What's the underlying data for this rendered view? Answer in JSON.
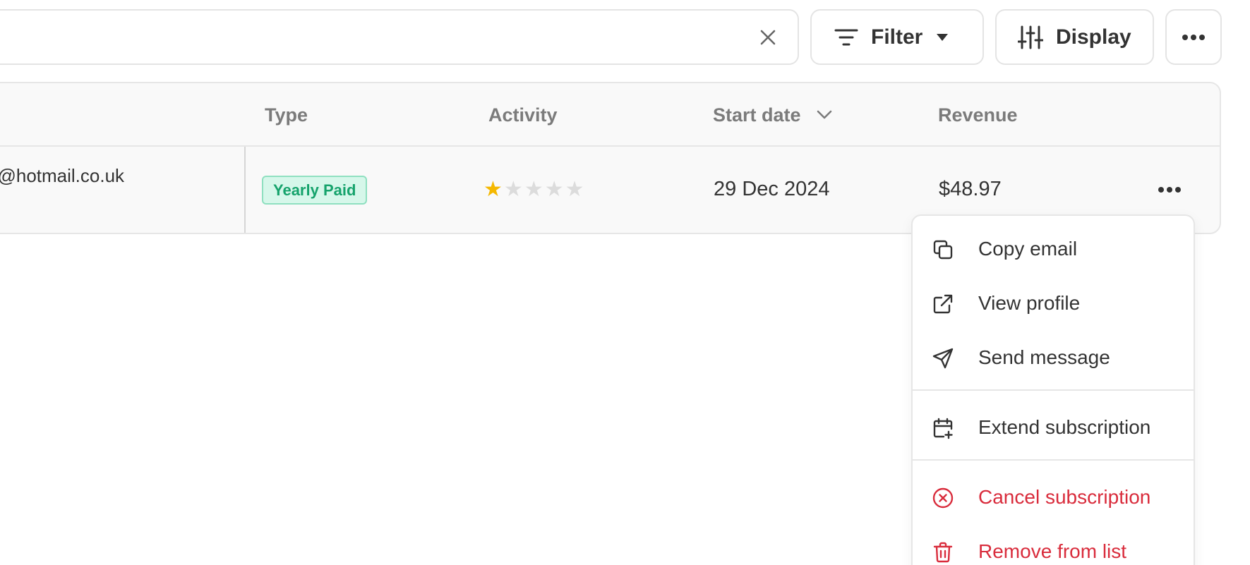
{
  "toolbar": {
    "filter_label": "Filter",
    "display_label": "Display"
  },
  "table": {
    "columns": {
      "type": "Type",
      "activity": "Activity",
      "start_date": "Start date",
      "revenue": "Revenue"
    },
    "rows": [
      {
        "email": "n@hotmail.co.uk",
        "sub": "n",
        "type_badge": "Yearly Paid",
        "activity_rating": 1,
        "activity_max": 5,
        "start_date": "29 Dec 2024",
        "revenue": "$48.97"
      }
    ]
  },
  "menu": {
    "items": [
      {
        "label": "Copy email",
        "icon": "copy-icon"
      },
      {
        "label": "View profile",
        "icon": "external-link-icon"
      },
      {
        "label": "Send message",
        "icon": "send-icon"
      },
      {
        "label": "Extend subscription",
        "icon": "calendar-plus-icon"
      },
      {
        "label": "Cancel subscription",
        "icon": "x-circle-icon"
      },
      {
        "label": "Remove from list",
        "icon": "trash-icon"
      }
    ]
  },
  "colors": {
    "accent_danger": "#d92c3c",
    "badge_green": "#16a36c",
    "star_on": "#f5b800"
  }
}
